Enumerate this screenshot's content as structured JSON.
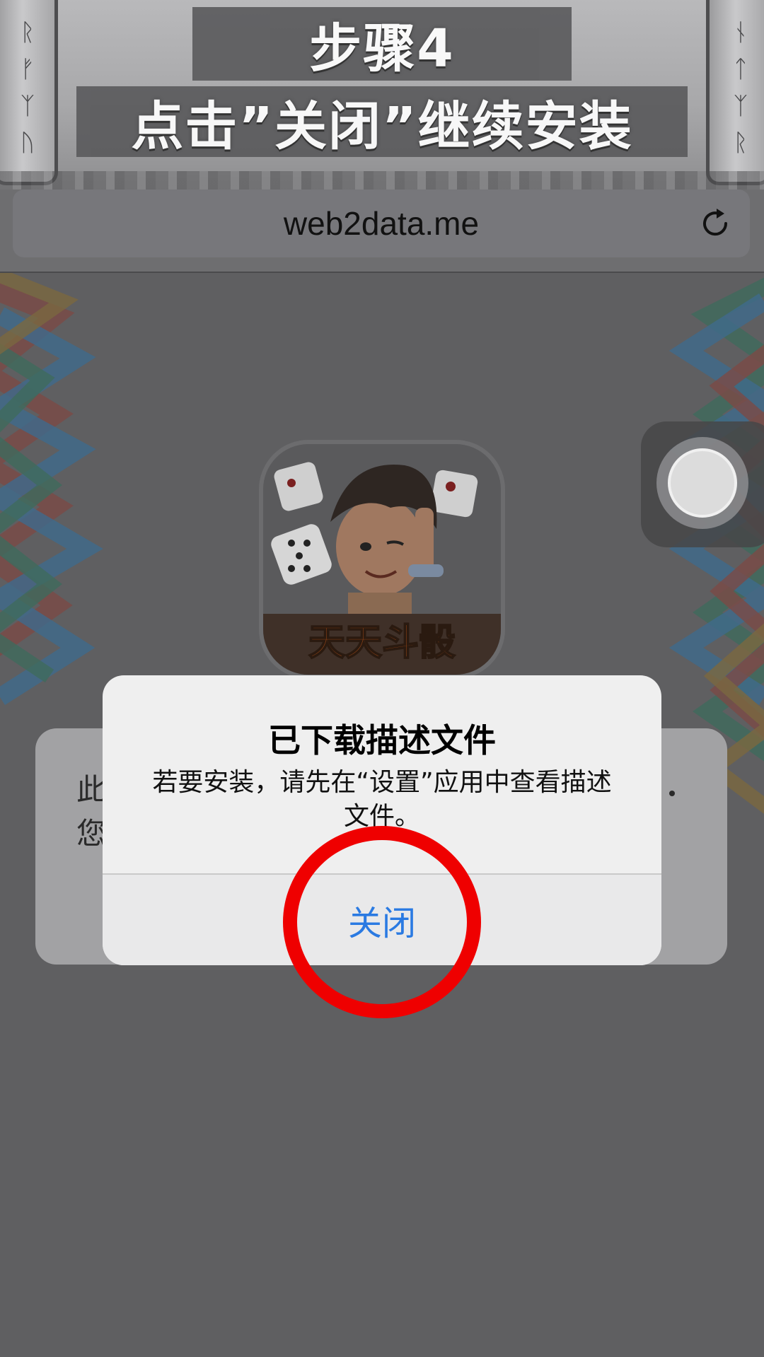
{
  "banner": {
    "step_title": "步骤4",
    "action_title": "点击”关闭”继续安装",
    "left_runes": [
      "ᚱ",
      "ᚠ",
      "ᛉ",
      "ᚢ"
    ],
    "right_runes": [
      "ᚾ",
      "ᛏ",
      "ᛉ",
      "ᚱ"
    ]
  },
  "browser": {
    "url": "web2data.me",
    "reload_icon": "reload-icon"
  },
  "background_dialog": {
    "line1_char": "此",
    "line2_char": "您"
  },
  "alert": {
    "title": "已下载描述文件",
    "message": "若要安装，请先在“设置”应用中查看描述文件。",
    "button_label": "关闭"
  },
  "colors": {
    "alert_button_text": "#2a7ae2",
    "highlight": "#ef0000"
  }
}
